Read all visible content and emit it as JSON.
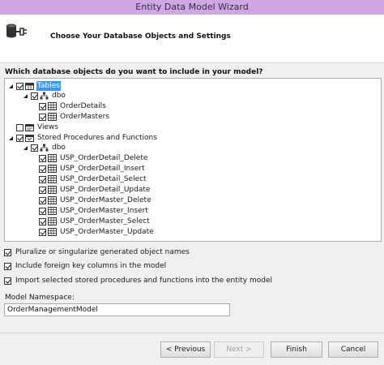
{
  "window": {
    "title": "Entity Data Model Wizard"
  },
  "header": {
    "title": "Choose Your Database Objects and Settings",
    "icon": "database-connect-icon"
  },
  "question": "Which database objects do you want to include in your model?",
  "tree": {
    "tables": {
      "label": "Tables",
      "checked": true,
      "expanded": true,
      "selected": true
    },
    "tables_schema": {
      "label": "dbo",
      "checked": true,
      "expanded": true
    },
    "tables_items": [
      {
        "label": "OrderDetails",
        "checked": true
      },
      {
        "label": "OrderMasters",
        "checked": true
      }
    ],
    "views": {
      "label": "Views",
      "checked": false
    },
    "procs": {
      "label": "Stored Procedures and Functions",
      "checked": true,
      "expanded": true
    },
    "procs_schema": {
      "label": "dbo",
      "checked": true,
      "expanded": true
    },
    "procs_items": [
      {
        "label": "USP_OrderDetail_Delete",
        "checked": true
      },
      {
        "label": "USP_OrderDetail_Insert",
        "checked": true
      },
      {
        "label": "USP_OrderDetail_Select",
        "checked": true
      },
      {
        "label": "USP_OrderDetail_Update",
        "checked": true
      },
      {
        "label": "USP_OrderMaster_Delete",
        "checked": true
      },
      {
        "label": "USP_OrderMaster_Insert",
        "checked": true
      },
      {
        "label": "USP_OrderMaster_Select",
        "checked": true
      },
      {
        "label": "USP_OrderMaster_Update",
        "checked": true
      }
    ]
  },
  "options": [
    {
      "label": "Pluralize or singularize generated object names",
      "checked": true
    },
    {
      "label": "Include foreign key columns in the model",
      "checked": true
    },
    {
      "label": "Import selected stored procedures and functions into the entity model",
      "checked": true
    }
  ],
  "namespace": {
    "label": "Model Namespace:",
    "value": "OrderManagementModel"
  },
  "buttons": {
    "previous": "< Previous",
    "next": "Next >",
    "finish": "Finish",
    "cancel": "Cancel"
  },
  "colors": {
    "titlebar": "#cfa8e3",
    "selection": "#3399ff"
  }
}
